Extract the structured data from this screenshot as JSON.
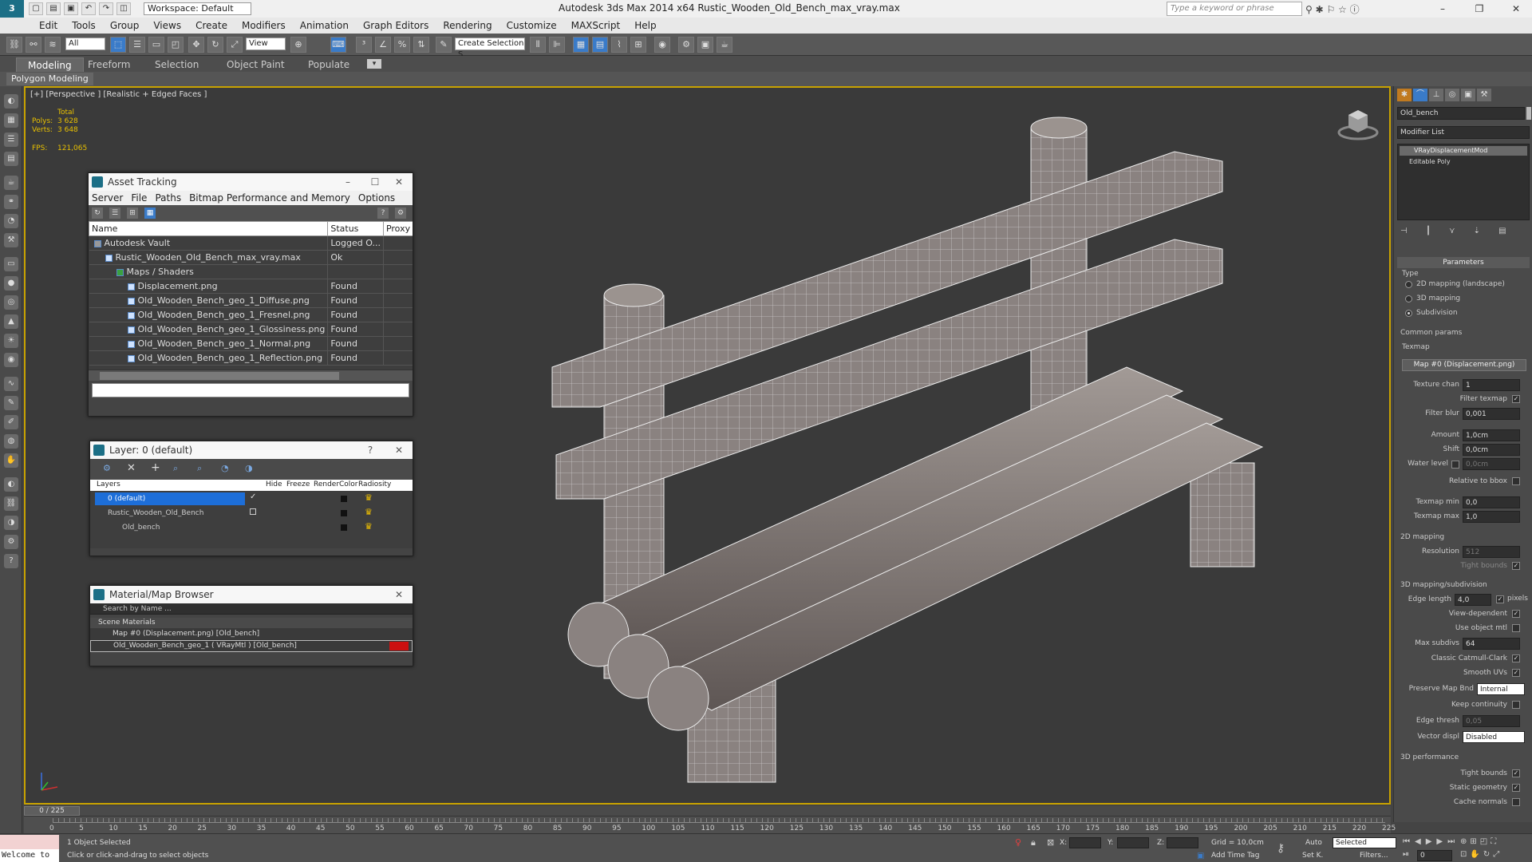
{
  "app": {
    "title": "Autodesk 3ds Max  2014 x64     Rustic_Wooden_Old_Bench_max_vray.max",
    "workspace": "Workspace: Default",
    "search_placeholder": "Type a keyword or phrase"
  },
  "menu": [
    "Edit",
    "Tools",
    "Group",
    "Views",
    "Create",
    "Modifiers",
    "Animation",
    "Graph Editors",
    "Rendering",
    "Customize",
    "MAXScript",
    "Help"
  ],
  "toolbar": {
    "selection_filter": "All",
    "ref_coord": "View",
    "named_selection": "Create Selection S"
  },
  "ribbon": {
    "tabs": [
      "Modeling",
      "Freeform",
      "Selection",
      "Object Paint",
      "Populate"
    ],
    "active_tab": "Modeling",
    "panel": "Polygon Modeling"
  },
  "viewport": {
    "label": "[+] [Perspective ] [Realistic + Edged Faces ]",
    "stats": {
      "total_label": "Total",
      "polys_label": "Polys:",
      "polys": "3 628",
      "verts_label": "Verts:",
      "verts": "3 648",
      "fps_label": "FPS:",
      "fps": "121,065"
    }
  },
  "asset_tracking": {
    "title": "Asset Tracking",
    "menu": [
      "Server",
      "File",
      "Paths",
      "Bitmap Performance and Memory",
      "Options"
    ],
    "columns": [
      "Name",
      "Status",
      "Proxy"
    ],
    "rows": [
      {
        "name": "Autodesk Vault",
        "status": "Logged O...",
        "indent": 0
      },
      {
        "name": "Rustic_Wooden_Old_Bench_max_vray.max",
        "status": "Ok",
        "indent": 1
      },
      {
        "name": "Maps / Shaders",
        "status": "",
        "indent": 2
      },
      {
        "name": "Displacement.png",
        "status": "Found",
        "indent": 3
      },
      {
        "name": "Old_Wooden_Bench_geo_1_Diffuse.png",
        "status": "Found",
        "indent": 3
      },
      {
        "name": "Old_Wooden_Bench_geo_1_Fresnel.png",
        "status": "Found",
        "indent": 3
      },
      {
        "name": "Old_Wooden_Bench_geo_1_Glossiness.png",
        "status": "Found",
        "indent": 3
      },
      {
        "name": "Old_Wooden_Bench_geo_1_Normal.png",
        "status": "Found",
        "indent": 3
      },
      {
        "name": "Old_Wooden_Bench_geo_1_Reflection.png",
        "status": "Found",
        "indent": 3
      }
    ]
  },
  "layer_window": {
    "title": "Layer: 0 (default)",
    "columns": [
      "Layers",
      "Hide",
      "Freeze",
      "Render",
      "Color",
      "Radiosity"
    ],
    "layers": [
      "0 (default)",
      "Rustic_Wooden_Old_Bench",
      "Old_bench"
    ]
  },
  "material_browser": {
    "title": "Material/Map Browser",
    "search_placeholder": "Search by Name ...",
    "group": "Scene Materials",
    "items": [
      "Map #0 (Displacement.png) [Old_bench]",
      "Old_Wooden_Bench_geo_1  ( VRayMtl )  [Old_bench]"
    ]
  },
  "command_panel": {
    "object_name": "Old_bench",
    "modifier_list": "Modifier List",
    "stack": [
      "VRayDisplacementMod",
      "Editable Poly"
    ],
    "parameters_title": "Parameters",
    "type_label": "Type",
    "type_options": [
      "2D mapping (landscape)",
      "3D mapping",
      "Subdivision"
    ],
    "common_params": "Common params",
    "texmap_label": "Texmap",
    "texmap_button": "Map #0 (Displacement.png)",
    "texture_chan_label": "Texture chan",
    "texture_chan": "1",
    "filter_texmap_label": "Filter texmap",
    "filter_blur_label": "Filter blur",
    "filter_blur": "0,001",
    "amount_label": "Amount",
    "amount": "1,0cm",
    "shift_label": "Shift",
    "shift": "0,0cm",
    "water_level_label": "Water level",
    "water_level": "0,0cm",
    "relative_bbox_label": "Relative to bbox",
    "texmap_min_label": "Texmap min",
    "texmap_min": "0,0",
    "texmap_max_label": "Texmap max",
    "texmap_max": "1,0",
    "mapping2d_title": "2D mapping",
    "resolution_label": "Resolution",
    "resolution": "512",
    "tight_bounds_label": "Tight bounds",
    "mapping3d_title": "3D mapping/subdivision",
    "edge_length_label": "Edge length",
    "edge_length": "4,0",
    "pixels_label": "pixels",
    "view_dependent_label": "View-dependent",
    "use_object_mtl_label": "Use object mtl",
    "max_subdivs_label": "Max subdivs",
    "max_subdivs": "64",
    "classic_catmull_label": "Classic Catmull-Clark",
    "smooth_uvs_label": "Smooth UVs",
    "preserve_map_bnd_label": "Preserve Map Bnd",
    "preserve_map_bnd": "Internal",
    "keep_continuity_label": "Keep continuity",
    "edge_thresh_label": "Edge thresh",
    "edge_thresh": "0,05",
    "vector_displ_label": "Vector displ",
    "vector_displ": "Disabled",
    "performance_title": "3D performance",
    "tight_bounds2_label": "Tight bounds",
    "static_geometry_label": "Static geometry",
    "cache_normals_label": "Cache normals"
  },
  "timeline": {
    "frame": "0 / 225",
    "ticks": [
      "0",
      "5",
      "10",
      "15",
      "20",
      "25",
      "30",
      "35",
      "40",
      "45",
      "50",
      "55",
      "60",
      "65",
      "70",
      "75",
      "80",
      "85",
      "90",
      "95",
      "100",
      "105",
      "110",
      "115",
      "120",
      "125",
      "130",
      "135",
      "140",
      "145",
      "150",
      "155",
      "160",
      "165",
      "170",
      "175",
      "180",
      "185",
      "190",
      "195",
      "200",
      "205",
      "210",
      "215",
      "220",
      "225"
    ]
  },
  "status": {
    "maxscript": "Welcome to",
    "selected": "1 Object Selected",
    "prompt": "Click or click-and-drag to select objects",
    "x_label": "X:",
    "y_label": "Y:",
    "z_label": "Z:",
    "grid": "Grid = 10,0cm",
    "add_time_tag": "Add Time Tag",
    "auto": "Auto",
    "set_key": "Set K.",
    "key_filter": "Selected",
    "filters": "Filters...",
    "frame_field": "0"
  }
}
